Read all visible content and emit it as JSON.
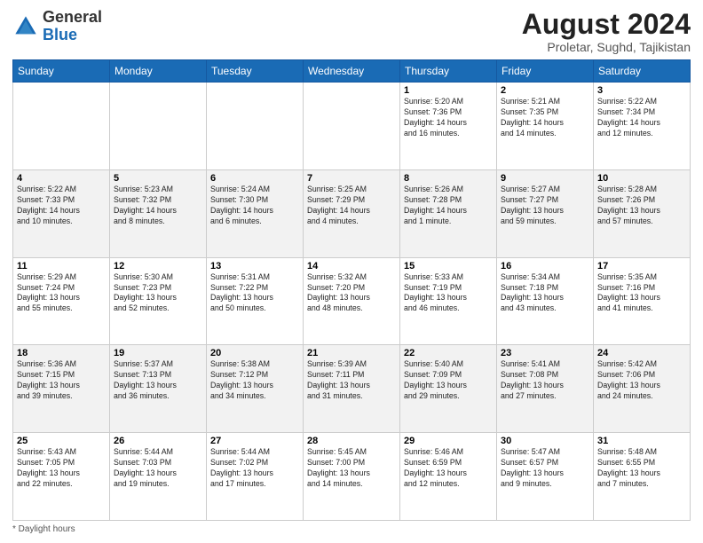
{
  "header": {
    "logo_general": "General",
    "logo_blue": "Blue",
    "month_year": "August 2024",
    "location": "Proletar, Sughd, Tajikistan"
  },
  "days_of_week": [
    "Sunday",
    "Monday",
    "Tuesday",
    "Wednesday",
    "Thursday",
    "Friday",
    "Saturday"
  ],
  "weeks": [
    [
      {
        "day": "",
        "info": ""
      },
      {
        "day": "",
        "info": ""
      },
      {
        "day": "",
        "info": ""
      },
      {
        "day": "",
        "info": ""
      },
      {
        "day": "1",
        "info": "Sunrise: 5:20 AM\nSunset: 7:36 PM\nDaylight: 14 hours\nand 16 minutes."
      },
      {
        "day": "2",
        "info": "Sunrise: 5:21 AM\nSunset: 7:35 PM\nDaylight: 14 hours\nand 14 minutes."
      },
      {
        "day": "3",
        "info": "Sunrise: 5:22 AM\nSunset: 7:34 PM\nDaylight: 14 hours\nand 12 minutes."
      }
    ],
    [
      {
        "day": "4",
        "info": "Sunrise: 5:22 AM\nSunset: 7:33 PM\nDaylight: 14 hours\nand 10 minutes."
      },
      {
        "day": "5",
        "info": "Sunrise: 5:23 AM\nSunset: 7:32 PM\nDaylight: 14 hours\nand 8 minutes."
      },
      {
        "day": "6",
        "info": "Sunrise: 5:24 AM\nSunset: 7:30 PM\nDaylight: 14 hours\nand 6 minutes."
      },
      {
        "day": "7",
        "info": "Sunrise: 5:25 AM\nSunset: 7:29 PM\nDaylight: 14 hours\nand 4 minutes."
      },
      {
        "day": "8",
        "info": "Sunrise: 5:26 AM\nSunset: 7:28 PM\nDaylight: 14 hours\nand 1 minute."
      },
      {
        "day": "9",
        "info": "Sunrise: 5:27 AM\nSunset: 7:27 PM\nDaylight: 13 hours\nand 59 minutes."
      },
      {
        "day": "10",
        "info": "Sunrise: 5:28 AM\nSunset: 7:26 PM\nDaylight: 13 hours\nand 57 minutes."
      }
    ],
    [
      {
        "day": "11",
        "info": "Sunrise: 5:29 AM\nSunset: 7:24 PM\nDaylight: 13 hours\nand 55 minutes."
      },
      {
        "day": "12",
        "info": "Sunrise: 5:30 AM\nSunset: 7:23 PM\nDaylight: 13 hours\nand 52 minutes."
      },
      {
        "day": "13",
        "info": "Sunrise: 5:31 AM\nSunset: 7:22 PM\nDaylight: 13 hours\nand 50 minutes."
      },
      {
        "day": "14",
        "info": "Sunrise: 5:32 AM\nSunset: 7:20 PM\nDaylight: 13 hours\nand 48 minutes."
      },
      {
        "day": "15",
        "info": "Sunrise: 5:33 AM\nSunset: 7:19 PM\nDaylight: 13 hours\nand 46 minutes."
      },
      {
        "day": "16",
        "info": "Sunrise: 5:34 AM\nSunset: 7:18 PM\nDaylight: 13 hours\nand 43 minutes."
      },
      {
        "day": "17",
        "info": "Sunrise: 5:35 AM\nSunset: 7:16 PM\nDaylight: 13 hours\nand 41 minutes."
      }
    ],
    [
      {
        "day": "18",
        "info": "Sunrise: 5:36 AM\nSunset: 7:15 PM\nDaylight: 13 hours\nand 39 minutes."
      },
      {
        "day": "19",
        "info": "Sunrise: 5:37 AM\nSunset: 7:13 PM\nDaylight: 13 hours\nand 36 minutes."
      },
      {
        "day": "20",
        "info": "Sunrise: 5:38 AM\nSunset: 7:12 PM\nDaylight: 13 hours\nand 34 minutes."
      },
      {
        "day": "21",
        "info": "Sunrise: 5:39 AM\nSunset: 7:11 PM\nDaylight: 13 hours\nand 31 minutes."
      },
      {
        "day": "22",
        "info": "Sunrise: 5:40 AM\nSunset: 7:09 PM\nDaylight: 13 hours\nand 29 minutes."
      },
      {
        "day": "23",
        "info": "Sunrise: 5:41 AM\nSunset: 7:08 PM\nDaylight: 13 hours\nand 27 minutes."
      },
      {
        "day": "24",
        "info": "Sunrise: 5:42 AM\nSunset: 7:06 PM\nDaylight: 13 hours\nand 24 minutes."
      }
    ],
    [
      {
        "day": "25",
        "info": "Sunrise: 5:43 AM\nSunset: 7:05 PM\nDaylight: 13 hours\nand 22 minutes."
      },
      {
        "day": "26",
        "info": "Sunrise: 5:44 AM\nSunset: 7:03 PM\nDaylight: 13 hours\nand 19 minutes."
      },
      {
        "day": "27",
        "info": "Sunrise: 5:44 AM\nSunset: 7:02 PM\nDaylight: 13 hours\nand 17 minutes."
      },
      {
        "day": "28",
        "info": "Sunrise: 5:45 AM\nSunset: 7:00 PM\nDaylight: 13 hours\nand 14 minutes."
      },
      {
        "day": "29",
        "info": "Sunrise: 5:46 AM\nSunset: 6:59 PM\nDaylight: 13 hours\nand 12 minutes."
      },
      {
        "day": "30",
        "info": "Sunrise: 5:47 AM\nSunset: 6:57 PM\nDaylight: 13 hours\nand 9 minutes."
      },
      {
        "day": "31",
        "info": "Sunrise: 5:48 AM\nSunset: 6:55 PM\nDaylight: 13 hours\nand 7 minutes."
      }
    ]
  ],
  "footer": {
    "note": "Daylight hours"
  }
}
